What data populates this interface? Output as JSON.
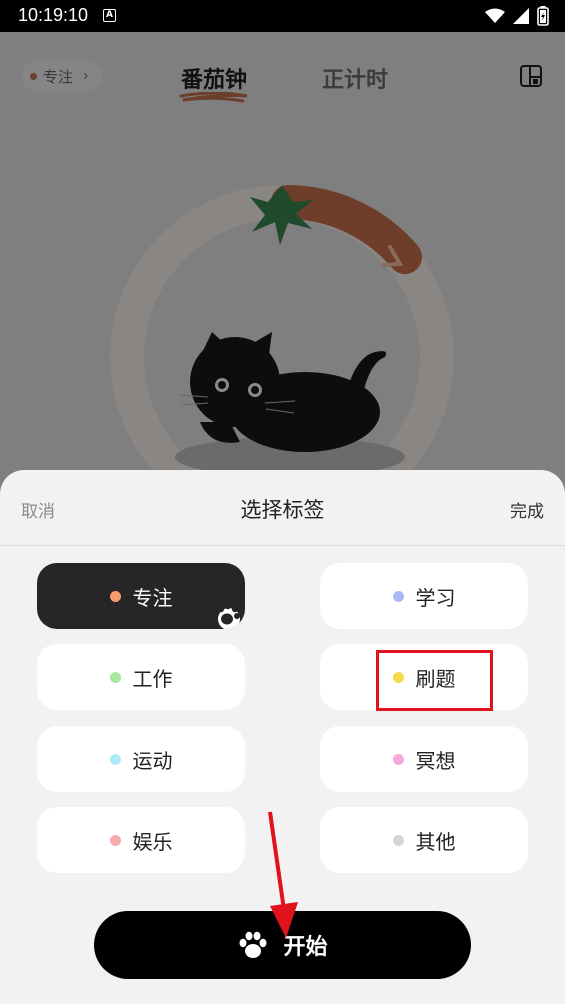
{
  "status_bar": {
    "time": "10:19:10",
    "notification_glyph": "A"
  },
  "background": {
    "tag_pill": {
      "label": "专注",
      "dot_color": "#6b3f2c"
    },
    "tabs": [
      {
        "label": "番茄钟",
        "active": true
      },
      {
        "label": "正计时",
        "active": false
      }
    ],
    "icons": [
      "stats-icon",
      "tomato-timer-ring",
      "black-cat-illustration"
    ]
  },
  "sheet": {
    "cancel_label": "取消",
    "title": "选择标签",
    "done_label": "完成",
    "tags": [
      {
        "label": "专注",
        "dot_color": "#f79b6f",
        "selected": true
      },
      {
        "label": "学习",
        "dot_color": "#a9b9f5",
        "selected": false
      },
      {
        "label": "工作",
        "dot_color": "#a6e8a0",
        "selected": false
      },
      {
        "label": "刷题",
        "dot_color": "#f6dc4d",
        "selected": false
      },
      {
        "label": "运动",
        "dot_color": "#aeeafa",
        "selected": false
      },
      {
        "label": "冥想",
        "dot_color": "#f7a8dd",
        "selected": false
      },
      {
        "label": "娱乐",
        "dot_color": "#f6a9a9",
        "selected": false
      },
      {
        "label": "其他",
        "dot_color": "#d4d4d4",
        "selected": false
      }
    ],
    "start_label": "开始"
  },
  "annotations": {
    "highlight_color": "#e0121b",
    "arrow_color": "#e0121b"
  }
}
